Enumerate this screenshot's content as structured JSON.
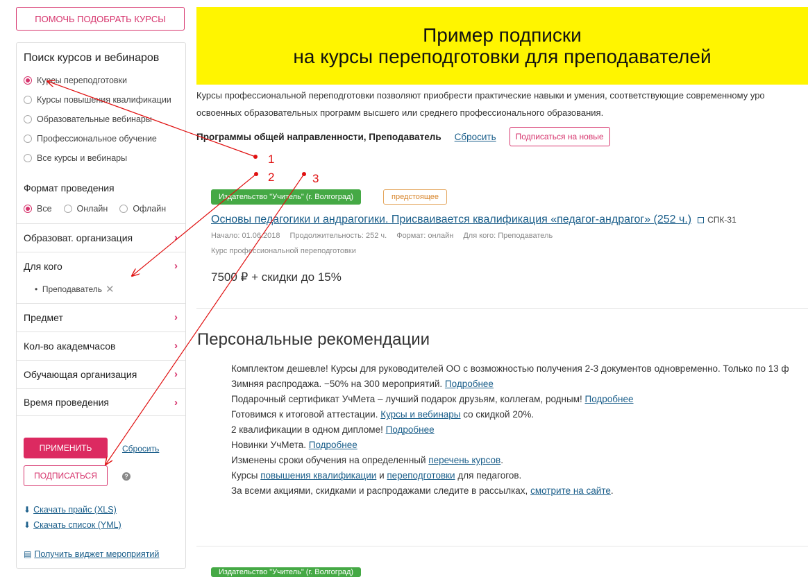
{
  "help_button": "ПОМОЧЬ ПОДОБРАТЬ КУРСЫ",
  "sidebar": {
    "title": "Поиск курсов и вебинаров",
    "course_types": [
      {
        "label": "Курсы переподготовки",
        "selected": true
      },
      {
        "label": "Курсы повышения квалификации",
        "selected": false
      },
      {
        "label": "Образовательные вебинары",
        "selected": false
      },
      {
        "label": "Профессиональное обучение",
        "selected": false
      },
      {
        "label": "Все курсы и вебинары",
        "selected": false
      }
    ],
    "format_title": "Формат проведения",
    "formats": [
      {
        "label": "Все",
        "selected": true
      },
      {
        "label": "Онлайн",
        "selected": false
      },
      {
        "label": "Офлайн",
        "selected": false
      }
    ],
    "sections": [
      "Образоват. организация",
      "Для кого",
      "Предмет",
      "Кол-во академчасов",
      "Обучающая организация",
      "Время проведения"
    ],
    "selected_filter": "Преподаватель",
    "apply_button": "ПРИМЕНИТЬ",
    "reset_link": "Сбросить",
    "subscribe_button": "ПОДПИСАТЬСЯ",
    "download_price": "Скачать прайс (XLS)",
    "download_list": "Скачать список (YML)",
    "widget_link": "Получить виджет мероприятий"
  },
  "banner": {
    "line1": "Пример подписки",
    "line2": "на курсы переподготовки для преподавателей"
  },
  "intro": {
    "line1": "Курсы профессиональной переподготовки позволяют приобрести практические навыки и умения, соответствующие современному уро",
    "line2": "освоенных образовательных программ высшего или среднего профессионального образования."
  },
  "program": {
    "label": "Программы общей направленности, Преподаватель",
    "reset": "Сбросить",
    "subscribe_new": "Подписаться на новые"
  },
  "course": {
    "publisher": "Издательство \"Учитель\" (г. Волгоград)",
    "status": "предстоящее",
    "title": "Основы педагогики и андрагогики. Присваивается квалификация «педагог-андрагог» (252 ч.)",
    "code": "СПК-31",
    "start": "Начало: 01.06.2018",
    "duration": "Продолжительность: 252 ч.",
    "format": "Формат: онлайн",
    "audience": "Для кого: Преподаватель",
    "type": "Курс профессиональной переподготовки",
    "price": "7500 ₽ + скидки до 15%"
  },
  "recommendations": {
    "title": "Персональные рекомендации",
    "items": [
      {
        "text": "Комплектом дешевле! Курсы для руководителей ОО с возможностью получения 2-3 документов одновременно. Только по 13 ф",
        "link": "",
        "after": ""
      },
      {
        "text": "Зимняя распродажа. −50% на 300 мероприятий. ",
        "link": "Подробнее",
        "after": ""
      },
      {
        "text": "Подарочный сертификат УчМета – лучший подарок друзьям, коллегам, родным! ",
        "link": "Подробнее",
        "after": ""
      },
      {
        "text": "Готовимся к итоговой аттестации. ",
        "link": "Курсы и вебинары",
        "after": " со скидкой 20%."
      },
      {
        "text": "2 квалификации в одном дипломе! ",
        "link": "Подробнее",
        "after": ""
      },
      {
        "text": "Новинки УчМета. ",
        "link": "Подробнее",
        "after": ""
      },
      {
        "text": "Изменены сроки обучения на определенный ",
        "link": "перечень курсов",
        "after": "."
      },
      {
        "text": "Курсы ",
        "link": "повышения квалификации",
        "after": " и ",
        "link2": "переподготовки",
        "after2": " для педагогов."
      },
      {
        "text": "За всеми акциями, скидками и распродажами следите в рассылках, ",
        "link": "смотрите на сайте",
        "after": "."
      }
    ]
  },
  "annotations": [
    "1",
    "2",
    "3"
  ],
  "colors": {
    "accent": "#d6336c",
    "banner": "#fff500",
    "green": "#45a945",
    "annotation": "#e01010"
  }
}
